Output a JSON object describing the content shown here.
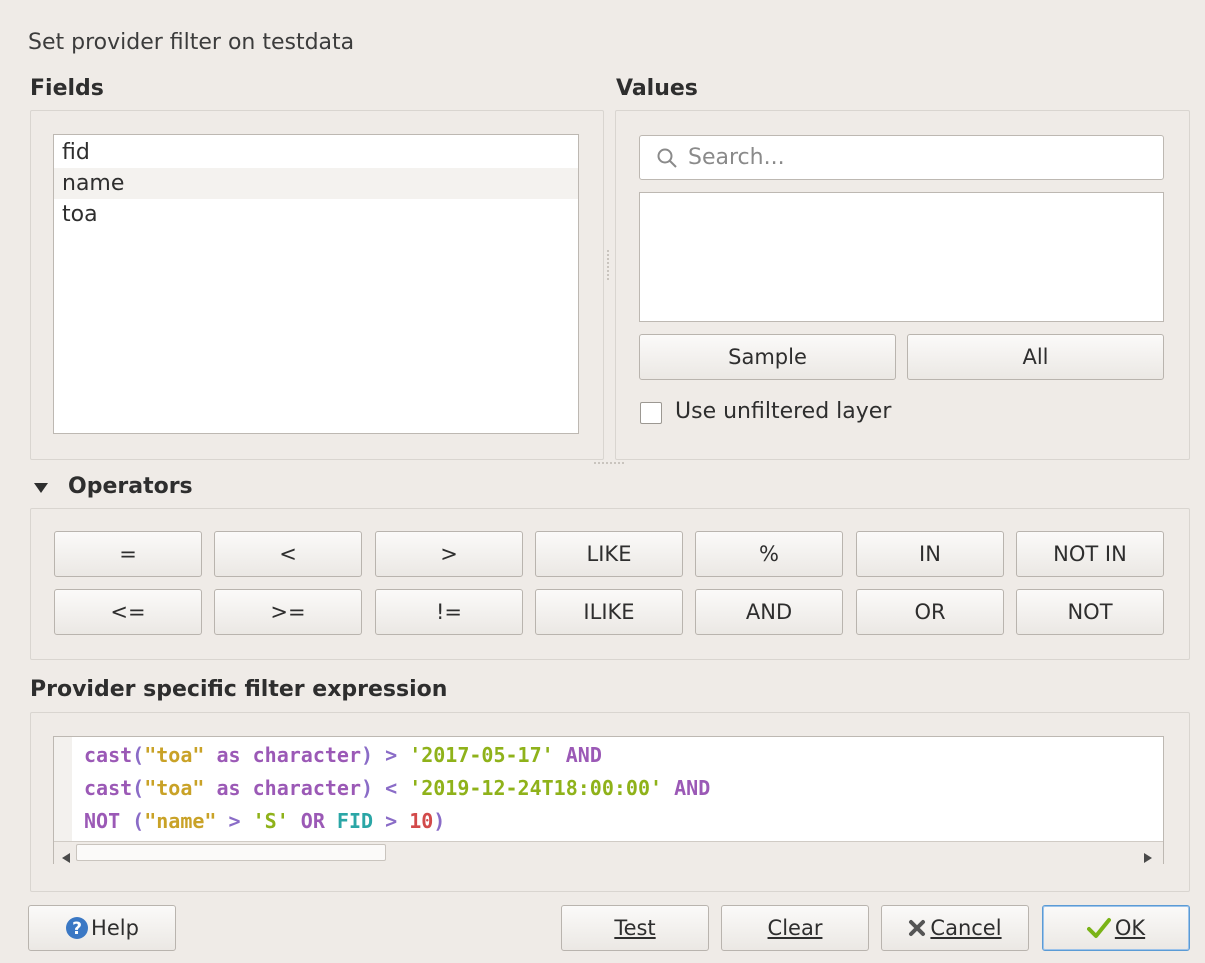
{
  "dialog": {
    "title": "Set provider filter on testdata"
  },
  "fields": {
    "label": "Fields",
    "items": [
      "fid",
      "name",
      "toa"
    ]
  },
  "values": {
    "label": "Values",
    "search_placeholder": "Search...",
    "sample_label": "Sample",
    "all_label": "All",
    "unfiltered_label": "Use unfiltered layer"
  },
  "operators": {
    "label": "Operators",
    "row1": [
      "=",
      "<",
      ">",
      "LIKE",
      "%",
      "IN",
      "NOT IN"
    ],
    "row2": [
      "<=",
      ">=",
      "!=",
      "ILIKE",
      "AND",
      "OR",
      "NOT"
    ]
  },
  "expression": {
    "label": "Provider specific filter expression",
    "line1": "cast(\"toa\" as character) > '2017-05-17' AND",
    "line2": "cast(\"toa\" as character) < '2019-12-24T18:00:00' AND",
    "line3": "NOT (\"name\" > 'S' OR FID > 10)"
  },
  "buttons": {
    "help": "Help",
    "test": "Test",
    "clear": "Clear",
    "cancel": "Cancel",
    "ok": "OK"
  },
  "icons": {
    "help": "help-icon",
    "cancel": "cancel-icon",
    "ok": "check-icon",
    "search": "search-icon",
    "collapse": "triangle-down-icon"
  },
  "colors": {
    "background": "#efebe7",
    "keyword": "#9b59b6",
    "string": "#c9a227",
    "literal": "#8fb21a",
    "number": "#d24a4a",
    "function": "#2aa6a6",
    "ok_border": "#5b9bd5"
  }
}
